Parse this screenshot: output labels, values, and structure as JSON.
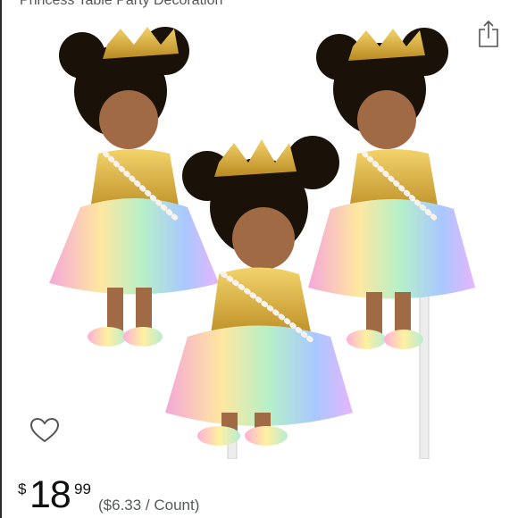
{
  "product": {
    "title": "Princess Table Party Decoration",
    "image_alt": "Three princess baby girl centerpiece sticks with gold crowns and rainbow tutus"
  },
  "icons": {
    "share": "share-icon",
    "wishlist": "heart-outline-icon"
  },
  "price": {
    "currency": "$",
    "whole": "18",
    "fraction": "99",
    "unit_price": "($6.33 / Count)"
  },
  "colors": {
    "price_text": "#0f1111",
    "secondary_text": "#565959"
  }
}
